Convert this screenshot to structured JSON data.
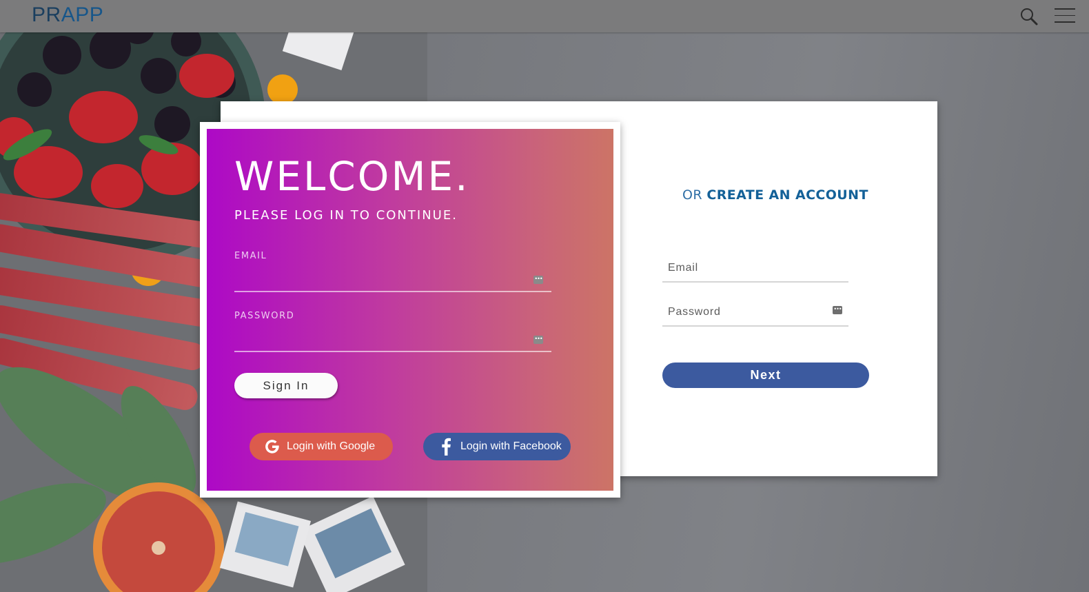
{
  "header": {
    "brand_part1": "PR",
    "brand_part2": "APP",
    "search_icon": "search-icon",
    "menu_icon": "hamburger-menu-icon"
  },
  "login": {
    "title": "WELCOME.",
    "subtitle": "PLEASE LOG IN TO CONTINUE.",
    "email_label": "EMAIL",
    "email_value": "",
    "password_label": "PASSWORD",
    "password_value": "",
    "signin_label": "Sign In",
    "google_label": "Login with Google",
    "facebook_label": "Login with Facebook"
  },
  "register": {
    "or_text": "OR ",
    "create_text": "CREATE AN ACCOUNT",
    "email_placeholder": "Email",
    "password_placeholder": "Password",
    "next_label": "Next"
  },
  "colors": {
    "gradient_start": "#ad09c6",
    "gradient_end": "#cc7466",
    "google_red": "#dc5b4c",
    "facebook_blue": "#3c5a9f",
    "brand_blue": "#17568a"
  }
}
